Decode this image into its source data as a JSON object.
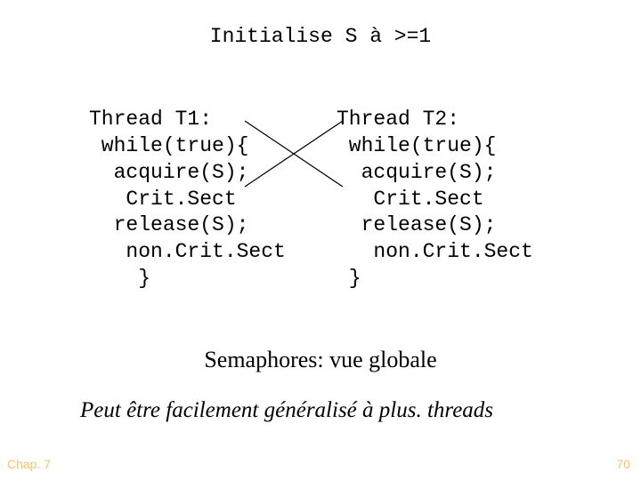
{
  "init_line": "Initialise S à >=1",
  "thread1": {
    "title": "Thread T1:",
    "l1": " while(true){",
    "l2": "  acquire(S);",
    "l3": "   Crit.Sect",
    "l4": "  release(S);",
    "l5": "   non.Crit.Sect",
    "l6": "    }"
  },
  "thread2": {
    "title": "Thread T2:",
    "l1": " while(true){",
    "l2": "  acquire(S);",
    "l3": "   Crit.Sect",
    "l4": "  release(S);",
    "l5": "   non.Crit.Sect",
    "l6": " }"
  },
  "subtitle": "Semaphores: vue globale",
  "note": "Peut être facilement généralisé à plus. threads",
  "footer": {
    "left": "Chap. 7",
    "right": "70"
  }
}
